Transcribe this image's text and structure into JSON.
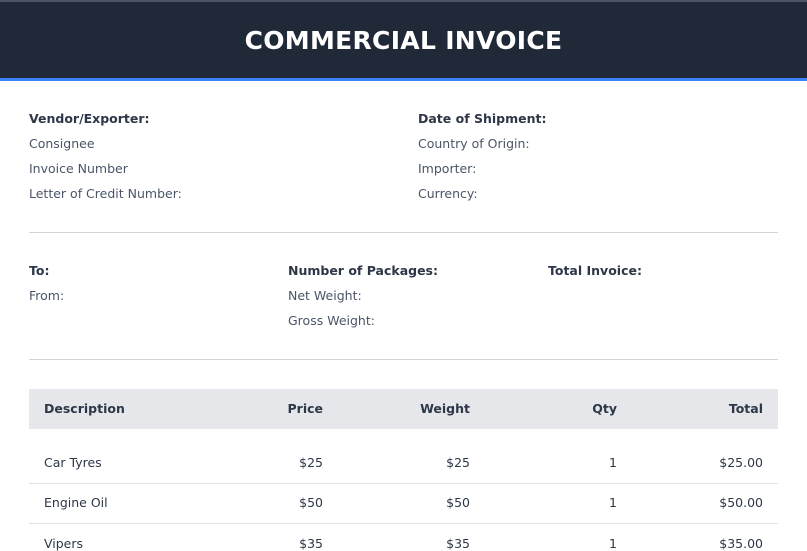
{
  "header": {
    "title": "COMMERCIAL INVOICE"
  },
  "section1": {
    "left": [
      "Vendor/Exporter:",
      "Consignee",
      "Invoice Number",
      "Letter of Credit Number:"
    ],
    "right": [
      "Date of Shipment:",
      "Country of Origin:",
      "Importer:",
      "Currency:"
    ]
  },
  "section2": {
    "col1": [
      "To:",
      "From:"
    ],
    "col2": [
      "Number of Packages:",
      "Net Weight:",
      "Gross Weight:"
    ],
    "col3": [
      "Total Invoice:"
    ]
  },
  "table": {
    "headers": [
      "Description",
      "Price",
      "Weight",
      "Qty",
      "Total"
    ],
    "rows": [
      [
        "Car Tyres",
        "$25",
        "$25",
        "1",
        "$25.00"
      ],
      [
        "Engine Oil",
        "$50",
        "$50",
        "1",
        "$50.00"
      ],
      [
        "Vipers",
        "$35",
        "$35",
        "1",
        "$35.00"
      ]
    ]
  },
  "colors": {
    "header_bg": "#1f2937",
    "accent": "#3b82f6",
    "table_head_bg": "#e5e7eb"
  }
}
